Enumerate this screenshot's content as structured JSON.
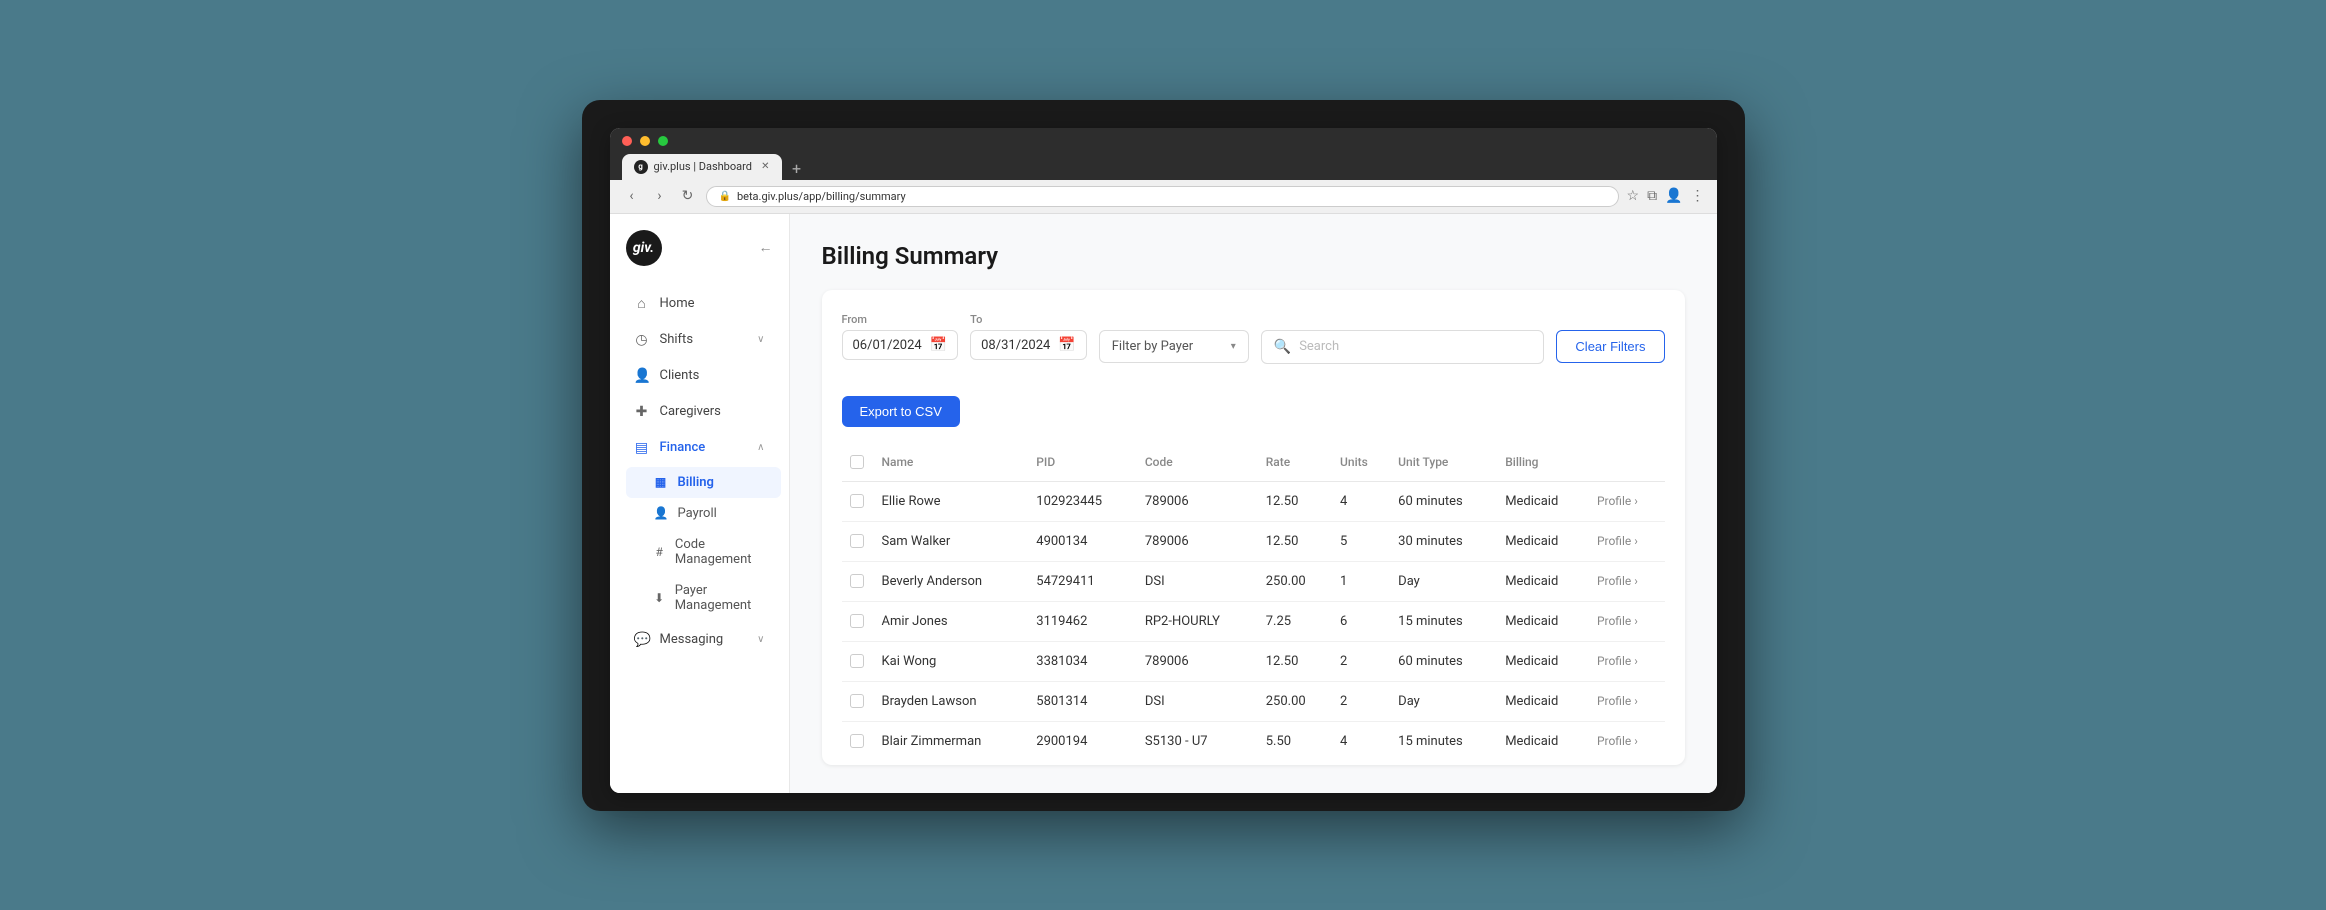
{
  "browser": {
    "tab_label": "giv.plus | Dashboard",
    "tab_favicon": "g",
    "address": "beta.giv.plus/app/billing/summary",
    "new_tab_label": "+"
  },
  "sidebar": {
    "logo_text": "giv.",
    "collapse_icon": "←",
    "nav_items": [
      {
        "id": "home",
        "label": "Home",
        "icon": "⌂",
        "active": false
      },
      {
        "id": "shifts",
        "label": "Shifts",
        "icon": "◷",
        "active": false,
        "chevron": "∨"
      },
      {
        "id": "clients",
        "label": "Clients",
        "icon": "👤",
        "active": false
      },
      {
        "id": "caregivers",
        "label": "Caregivers",
        "icon": "🧑‍⚕️",
        "active": false
      },
      {
        "id": "finance",
        "label": "Finance",
        "icon": "💳",
        "active": true,
        "chevron": "∧",
        "subitems": [
          {
            "id": "billing",
            "label": "Billing",
            "active": true
          },
          {
            "id": "payroll",
            "label": "Payroll",
            "active": false
          },
          {
            "id": "code-management",
            "label": "Code Management",
            "active": false
          },
          {
            "id": "payer-management",
            "label": "Payer Management",
            "active": false
          }
        ]
      },
      {
        "id": "messaging",
        "label": "Messaging",
        "icon": "💬",
        "active": false,
        "chevron": "∨"
      }
    ]
  },
  "main": {
    "page_title": "Billing Summary",
    "filters": {
      "from_label": "From",
      "from_value": "06/01/2024",
      "to_label": "To",
      "to_value": "08/31/2024",
      "payer_placeholder": "Filter by Payer",
      "search_placeholder": "Search",
      "clear_label": "Clear Filters",
      "export_label": "Export to CSV"
    },
    "table": {
      "columns": [
        "",
        "Name",
        "PID",
        "Code",
        "Rate",
        "Units",
        "Unit Type",
        "Billing",
        ""
      ],
      "rows": [
        {
          "name": "Ellie Rowe",
          "pid": "102923445",
          "code": "789006",
          "rate": "12.50",
          "units": "4",
          "unit_type": "60 minutes",
          "billing": "Medicaid",
          "profile": "Profile ›"
        },
        {
          "name": "Sam Walker",
          "pid": "4900134",
          "code": "789006",
          "rate": "12.50",
          "units": "5",
          "unit_type": "30 minutes",
          "billing": "Medicaid",
          "profile": "Profile ›"
        },
        {
          "name": "Beverly Anderson",
          "pid": "54729411",
          "code": "DSI",
          "rate": "250.00",
          "units": "1",
          "unit_type": "Day",
          "billing": "Medicaid",
          "profile": "Profile ›"
        },
        {
          "name": "Amir Jones",
          "pid": "3119462",
          "code": "RP2-HOURLY",
          "rate": "7.25",
          "units": "6",
          "unit_type": "15 minutes",
          "billing": "Medicaid",
          "profile": "Profile ›"
        },
        {
          "name": "Kai Wong",
          "pid": "3381034",
          "code": "789006",
          "rate": "12.50",
          "units": "2",
          "unit_type": "60 minutes",
          "billing": "Medicaid",
          "profile": "Profile ›"
        },
        {
          "name": "Brayden Lawson",
          "pid": "5801314",
          "code": "DSI",
          "rate": "250.00",
          "units": "2",
          "unit_type": "Day",
          "billing": "Medicaid",
          "profile": "Profile ›"
        },
        {
          "name": "Blair Zimmerman",
          "pid": "2900194",
          "code": "S5130 - U7",
          "rate": "5.50",
          "units": "4",
          "unit_type": "15 minutes",
          "billing": "Medicaid",
          "profile": "Profile ›"
        }
      ]
    }
  }
}
